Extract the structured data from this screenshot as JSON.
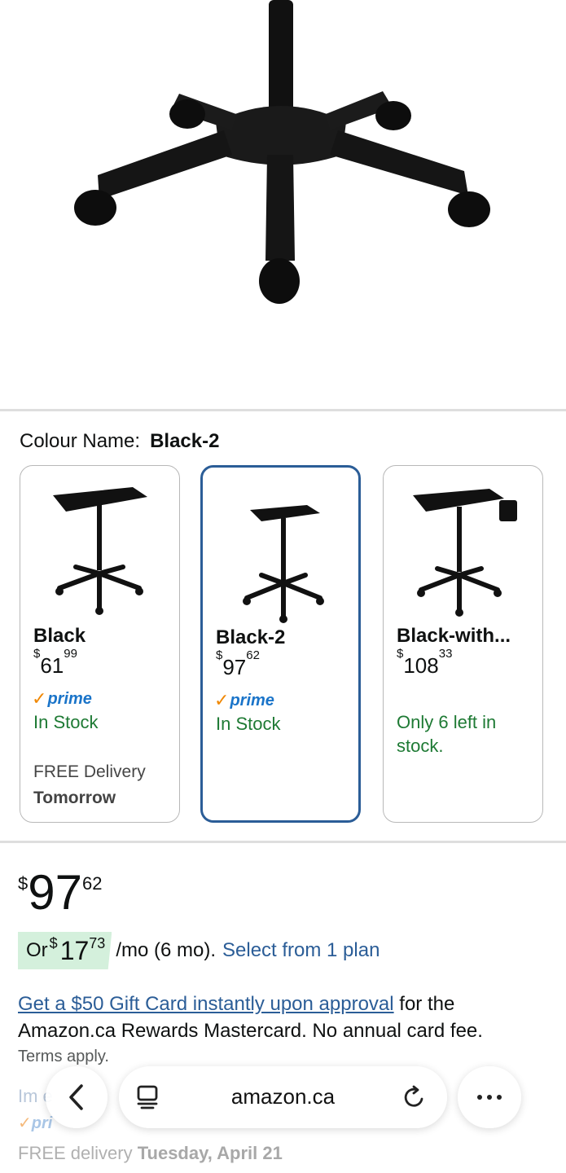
{
  "gallery": {
    "image_alt": "Black rolling tray stand base with five caster wheels",
    "dot_count": 5,
    "active_index": 0,
    "icons": [
      "heart-icon",
      "share-icon"
    ]
  },
  "colour": {
    "label": "Colour Name:",
    "selected": "Black-2"
  },
  "variants": [
    {
      "name": "Black",
      "price_symbol": "$",
      "price_whole": "61",
      "price_frac": "99",
      "prime": "prime",
      "stock": "In Stock",
      "delivery_line1": "FREE Delivery",
      "delivery_line2": "Tomorrow"
    },
    {
      "name": "Black-2",
      "price_symbol": "$",
      "price_whole": "97",
      "price_frac": "62",
      "prime": "prime",
      "stock": "In Stock"
    },
    {
      "name": "Black-with...",
      "price_symbol": "$",
      "price_whole": "108",
      "price_frac": "33",
      "stock": "Only 6 left in stock."
    }
  ],
  "price": {
    "symbol": "$",
    "whole": "97",
    "frac": "62"
  },
  "monthly": {
    "prefix": "Or",
    "symbol": "$",
    "whole": "17",
    "frac": "73",
    "suffix": "/mo (6 mo).",
    "link": "Select from 1 plan"
  },
  "offer": {
    "link": "Get a $50 Gift Card instantly upon approval",
    "text": " for the Amazon.ca Rewards Mastercard. No annual card fee.",
    "terms": "Terms apply."
  },
  "below": {
    "faded_text": "Im        e",
    "prime": "pri",
    "free_delivery": "FREE delivery",
    "delivery_date": "Tuesday, April 21"
  },
  "browser": {
    "url": "amazon.ca"
  },
  "colors": {
    "link": "#2b5d97",
    "stock_green": "#1e7a34",
    "prime_blue": "#1a74c9",
    "prime_check": "#f08804",
    "badge_bg": "#d4f0dc",
    "selected_border": "#2b5d97"
  }
}
